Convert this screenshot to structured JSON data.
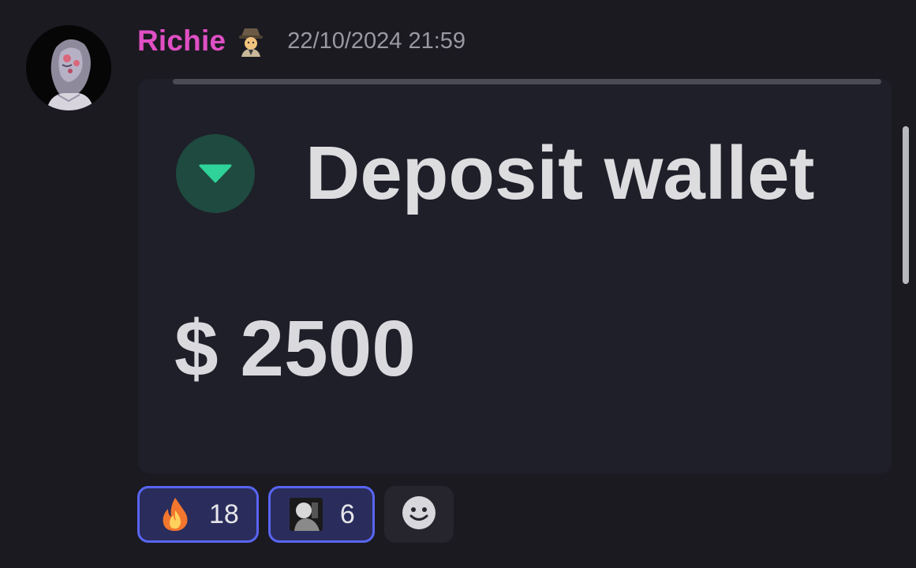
{
  "message": {
    "author": "Richie",
    "author_color": "#e04fc4",
    "role_icon": "detective-emoji",
    "timestamp": "22/10/2024 21:59",
    "avatar": "user-avatar"
  },
  "embed": {
    "title": "Deposit wallet",
    "icon": "arrow-down-icon",
    "icon_bg": "#1f4a3f",
    "icon_color": "#2fd39a",
    "amount": "$ 2500"
  },
  "reactions": [
    {
      "emoji": "fire-emoji",
      "count": "18"
    },
    {
      "emoji": "custom-avatar-emoji",
      "count": "6"
    }
  ],
  "add_reaction": {
    "icon": "smiley-icon"
  },
  "colors": {
    "background": "#1b1a21",
    "embed_bg": "#1e1f29",
    "reaction_border": "#5865f2",
    "reaction_bg": "#2a2d5c"
  }
}
